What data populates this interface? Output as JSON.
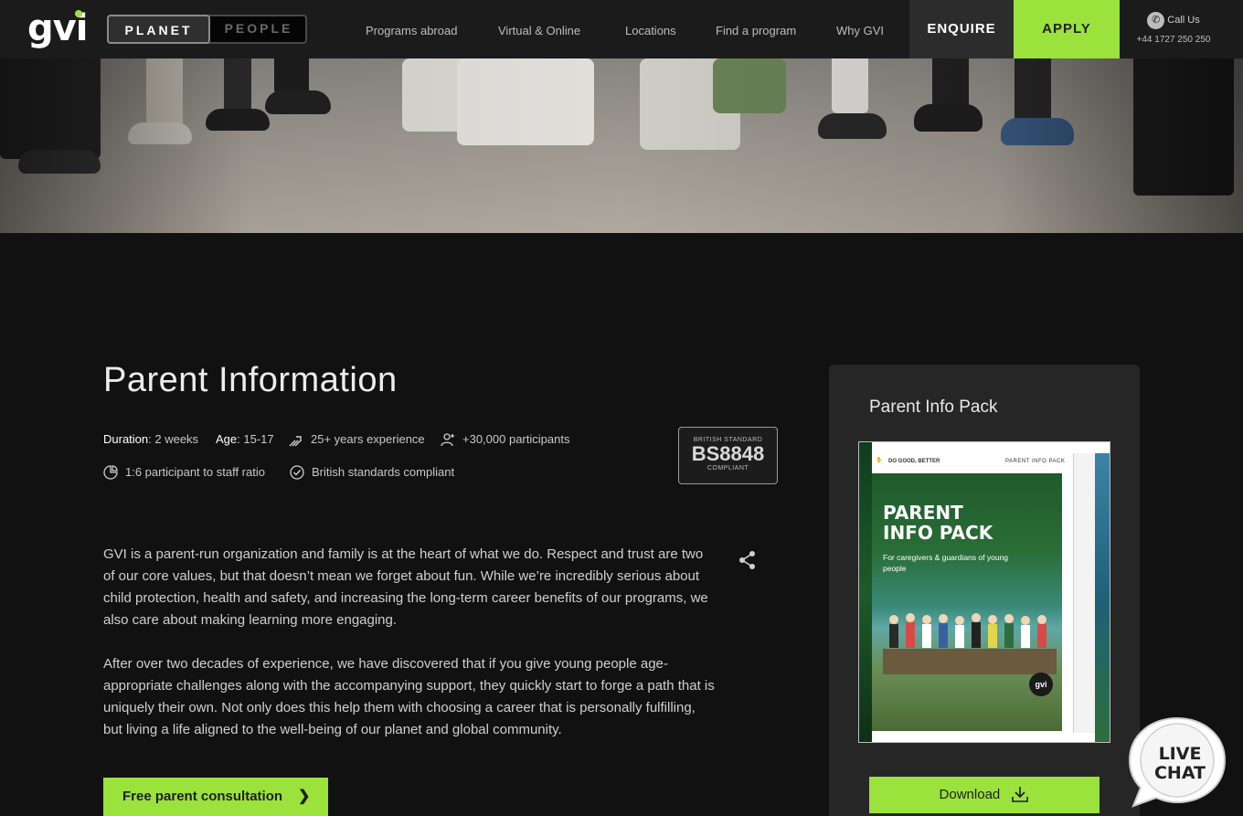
{
  "header": {
    "logo": "gvi",
    "toggle": {
      "planet": "PLANET",
      "people": "PEOPLE"
    },
    "nav": [
      "Programs abroad",
      "Virtual & Online",
      "Locations",
      "Find a program",
      "Why GVI"
    ],
    "enquire": "ENQUIRE",
    "apply": "APPLY",
    "call_label": "Call Us",
    "phone": "+44 1727 250 250"
  },
  "main": {
    "title": "Parent Information",
    "duration_label": "Duration",
    "duration_value": ": 2 weeks",
    "age_label": "Age",
    "age_value": ": 15-17",
    "experience": "25+ years experience",
    "participants": "+30,000 participants",
    "ratio": "1:6 participant to staff ratio",
    "compliant": "British standards compliant",
    "badge": {
      "line1": "BRITISH STANDARD",
      "line2": "BS8848",
      "line3": "COMPLIANT"
    },
    "paragraphs": [
      "GVI is a parent-run organization and family is at the heart of what we do. Respect and trust are two of our core values, but that doesn’t mean we forget about fun. While we’re incredibly serious about child protection, health and safety, and increasing the long-term career benefits of our programs, we also care about making learning more engaging.",
      "After over two decades of experience, we have discovered that if you give young people age-appropriate challenges along with the accompanying support, they quickly start to forge a path that is uniquely their own. Not only does this help them with choosing a career that is personally fulfilling, but living a life aligned to the well-being of our planet and global community."
    ],
    "consult_button": "Free parent consultation"
  },
  "sidebar": {
    "title": "Parent Info Pack",
    "cover": {
      "tagline": "DO GOOD, BETTER",
      "header": "PARENT INFO PACK",
      "title_line1": "PARENT",
      "title_line2": "INFO PACK",
      "subtitle": "For caregivers & guardians of young people",
      "logo": "gvi"
    },
    "download": "Download"
  },
  "chat": {
    "line1": "LIVE",
    "line2": "CHAT"
  },
  "colors": {
    "accent": "#9be23c",
    "background": "#111111",
    "header": "#1b1b1b",
    "card": "#262626"
  }
}
